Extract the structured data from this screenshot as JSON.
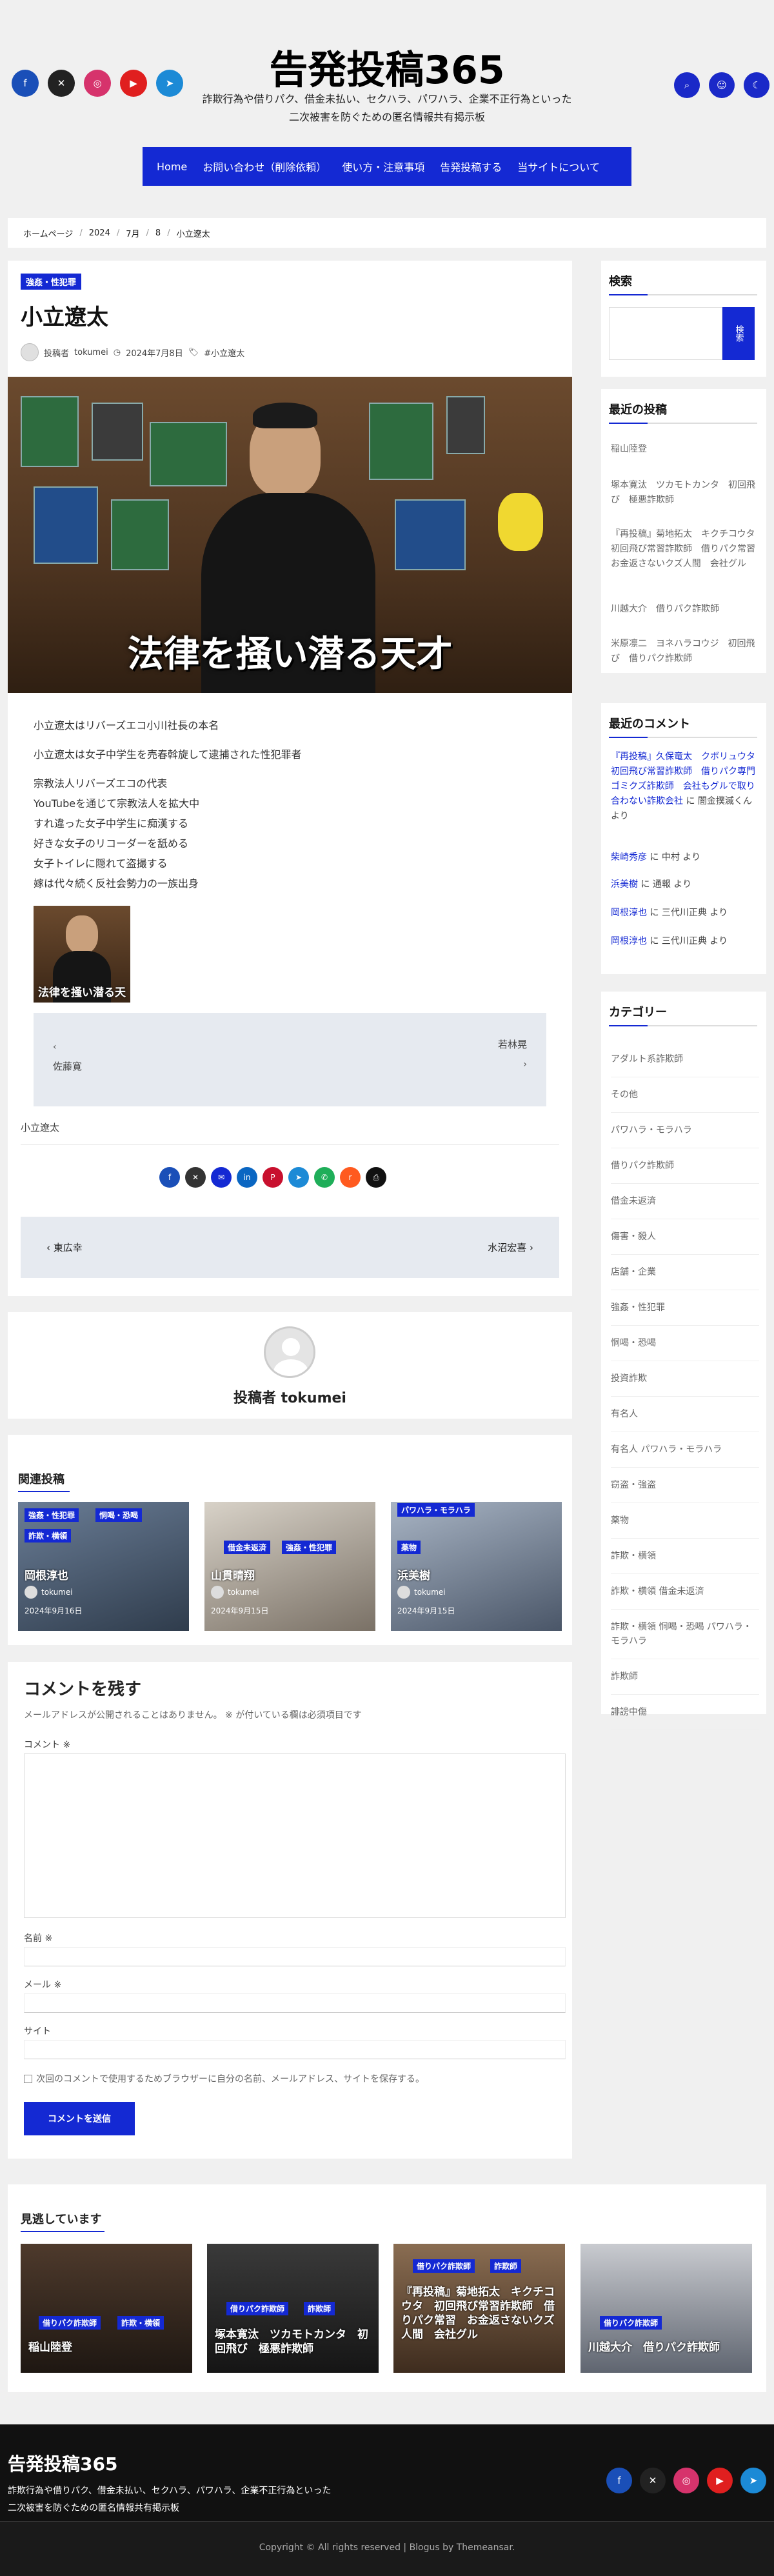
{
  "site": {
    "title": "告発投稿365",
    "description_line1": "詐欺行為や借りパク、借金未払い、セクハラ、パワハラ、企業不正行為といった",
    "description_line2": "二次被害を防ぐための匿名情報共有掲示板"
  },
  "social_left": [
    {
      "icon": "facebook-icon",
      "glyph": "f",
      "color": "#1a4fb8"
    },
    {
      "icon": "x-twitter-icon",
      "glyph": "✕",
      "color": "#222222"
    },
    {
      "icon": "instagram-icon",
      "glyph": "◎",
      "color": "#d6336c"
    },
    {
      "icon": "youtube-icon",
      "glyph": "▶",
      "color": "#e01f1f"
    },
    {
      "icon": "telegram-icon",
      "glyph": "➤",
      "color": "#1c8ad6"
    }
  ],
  "util_right": [
    {
      "icon": "search-icon",
      "glyph": "⌕"
    },
    {
      "icon": "user-icon",
      "glyph": "☺"
    },
    {
      "icon": "moon-icon",
      "glyph": "☾"
    }
  ],
  "nav": [
    "Home",
    "お問い合わせ（削除依頼）",
    "使い方・注意事項",
    "告発投稿する",
    "当サイトについて"
  ],
  "breadcrumb": [
    "ホームページ",
    "2024",
    "7月",
    "8",
    "小立遼太"
  ],
  "post": {
    "category": "強姦・性犯罪",
    "title": "小立遼太",
    "author_prefix": "投稿者",
    "author": "tokumei",
    "date": "2024年7月8日",
    "tag": "#小立遼太",
    "image_caption": "法律を掻い潜る天才",
    "paragraph1": "小立遼太はリバーズエコ小川社長の本名",
    "paragraph2": "小立遼太は女子中学生を売春斡旋して逮捕された性犯罪者",
    "list": [
      "宗教法人リバーズエコの代表",
      "YouTubeを通じて宗教法人を拡大中",
      "すれ違った女子中学生に痴漢する",
      "好きな女子のリコーダーを舐める",
      "女子トイレに隠れて盗撮する",
      "嫁は代々続く反社会勢力の一族出身"
    ],
    "thumb_caption": "法律を掻い潜る天",
    "prev_label": "佐藤寛",
    "next_label": "若林晃",
    "tag_line": "小立遼太",
    "post_prev": "東広幸",
    "post_next": "水沼宏喜"
  },
  "share_icons": [
    {
      "icon": "facebook-share-icon",
      "color": "#1a4fb8",
      "glyph": "f"
    },
    {
      "icon": "x-share-icon",
      "color": "#333333",
      "glyph": "✕"
    },
    {
      "icon": "email-share-icon",
      "color": "#1429d3",
      "glyph": "✉"
    },
    {
      "icon": "linkedin-share-icon",
      "color": "#0a66c2",
      "glyph": "in"
    },
    {
      "icon": "pinterest-share-icon",
      "color": "#c8102e",
      "glyph": "P"
    },
    {
      "icon": "telegram-share-icon",
      "color": "#1c8ad6",
      "glyph": "➤"
    },
    {
      "icon": "whatsapp-share-icon",
      "color": "#1fae59",
      "glyph": "✆"
    },
    {
      "icon": "reddit-share-icon",
      "color": "#ff5a1f",
      "glyph": "r"
    },
    {
      "icon": "print-share-icon",
      "color": "#111111",
      "glyph": "⎙"
    }
  ],
  "author_box": {
    "label": "投稿者 tokumei"
  },
  "related": {
    "heading": "関連投稿",
    "items": [
      {
        "title": "岡根淳也",
        "author": "tokumei",
        "date": "2024年9月16日",
        "badges": [
          "強姦・性犯罪",
          "恫喝・恐喝",
          "詐欺・横領"
        ]
      },
      {
        "title": "山貫晴翔",
        "author": "tokumei",
        "date": "2024年9月15日",
        "badges": [
          "借金未返済",
          "強姦・性犯罪"
        ]
      },
      {
        "title": "浜美樹",
        "author": "tokumei",
        "date": "2024年9月15日",
        "badges": [
          "パワハラ・モラハラ",
          "薬物"
        ]
      }
    ]
  },
  "comment_form": {
    "heading": "コメントを残す",
    "note": "メールアドレスが公開されることはありません。 ※ が付いている欄は必須項目です",
    "comment_label": "コメント ※",
    "name_label": "名前 ※",
    "email_label": "メール ※",
    "site_label": "サイト",
    "save_label": "次回のコメントで使用するためブラウザーに自分の名前、メールアドレス、サイトを保存する。",
    "submit": "コメントを送信"
  },
  "sidebar": {
    "search_title": "検索",
    "search_button": "検索",
    "recent_title": "最近の投稿",
    "recent": [
      "稲山陸登",
      "塚本寛汰　ツカモトカンタ　初回飛び　極悪詐欺師",
      "『再投稿』菊地拓太　キクチコウタ　初回飛び常習詐欺師　借りパク常習　お金返さないクズ人間　会社グル",
      "川越大介　借りパク詐欺師",
      "米原凛二　ヨネハラコウジ　初回飛び　借りパク詐欺師"
    ],
    "comments_title": "最近のコメント",
    "comments": [
      {
        "link": "『再投稿』久保竜太　クボリュウタ　初回飛び常習詐欺師　借りパク専門ゴミクズ詐欺師　会社もグルで取り合わない詐欺会社",
        "by": "に 闇金撲滅くん より"
      },
      {
        "link": "柴崎秀彦",
        "by": "に 中村 より"
      },
      {
        "link": "浜美樹",
        "by": "に 通報 より"
      },
      {
        "link": "岡根淳也",
        "by": "に 三代川正典 より"
      },
      {
        "link": "岡根淳也",
        "by": "に 三代川正典 より"
      }
    ],
    "categories_title": "カテゴリー",
    "categories": [
      "アダルト系詐欺師",
      "その他",
      "パワハラ・モラハラ",
      "借りパク詐欺師",
      "借金未返済",
      "傷害・殺人",
      "店舗・企業",
      "強姦・性犯罪",
      "恫喝・恐喝",
      "投資詐欺",
      "有名人",
      "有名人 パワハラ・モラハラ",
      "窃盗・強盗",
      "薬物",
      "詐欺・横領",
      "詐欺・横領 借金未返済",
      "詐欺・横領 恫喝・恐喝 パワハラ・モラハラ",
      "詐欺師",
      "誹謗中傷"
    ]
  },
  "trending": {
    "heading": "見逃しています",
    "items": [
      {
        "title": "稲山陸登",
        "badges": [
          "借りパク詐欺師",
          "詐欺・横領"
        ]
      },
      {
        "title": "塚本寛汰　ツカモトカンタ　初回飛び　極悪詐欺師",
        "badges": [
          "借りパク詐欺師",
          "詐欺師"
        ]
      },
      {
        "title": "『再投稿』菊地拓太　キクチコウタ　初回飛び常習詐欺師　借りパク常習　お金返さないクズ人間　会社グル",
        "badges": [
          "借りパク詐欺師",
          "詐欺師"
        ]
      },
      {
        "title": "川越大介　借りパク詐欺師",
        "badges": [
          "借りパク詐欺師"
        ]
      }
    ]
  },
  "footer": {
    "title": "告発投稿365",
    "desc1": "詐欺行為や借りパク、借金未払い、セクハラ、パワハラ、企業不正行為といった",
    "desc2": "二次被害を防ぐための匿名情報共有掲示板",
    "copyright": "Copyright © All rights reserved | Blogus by Themeansar."
  },
  "colors": {
    "accent": "#1429d3",
    "background": "#f0f0f0",
    "footer": "#111111"
  }
}
